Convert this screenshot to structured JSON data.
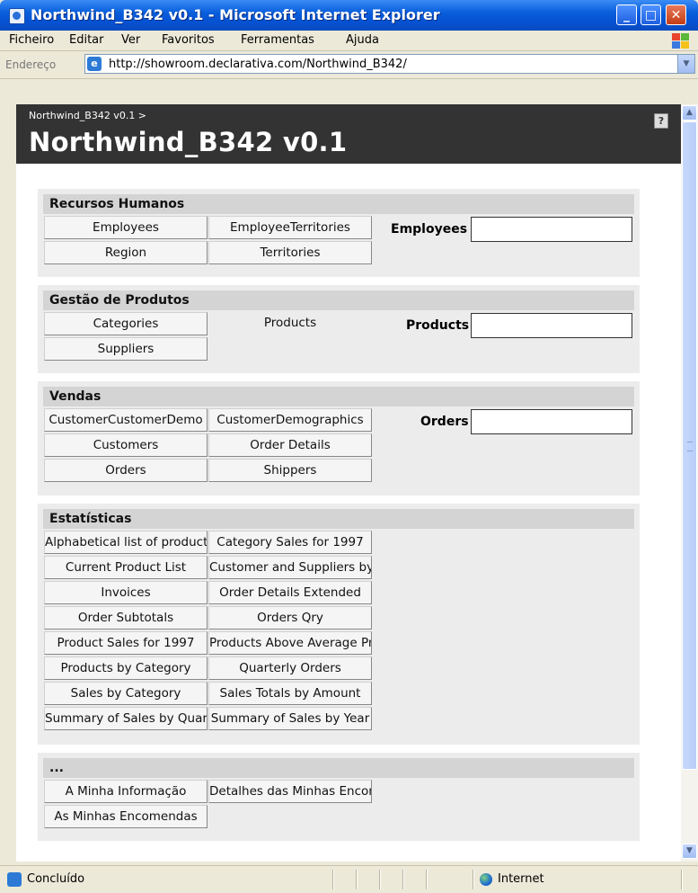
{
  "window": {
    "title": "Northwind_B342 v0.1 - Microsoft Internet Explorer",
    "minimize": "_",
    "maximize": "□",
    "close": "✕"
  },
  "menu": [
    "Ficheiro",
    "Editar",
    "Ver",
    "Favoritos",
    "Ferramentas",
    "Ajuda"
  ],
  "address": {
    "label": "Endereço",
    "url": "http://showroom.declarativa.com/Northwind_B342/"
  },
  "page": {
    "breadcrumb": "Northwind_B342 v0.1 >",
    "title": "Northwind_B342 v0.1",
    "help": "?"
  },
  "sections": [
    {
      "heading": "Recursos Humanos",
      "buttons": [
        "Employees",
        "EmployeeTerritories",
        "Region",
        "Territories"
      ],
      "field_label": "Employees"
    },
    {
      "heading": "Gestão de Produtos",
      "buttons": [
        "Categories",
        "Products",
        "Suppliers"
      ],
      "field_label": "Products"
    },
    {
      "heading": "Vendas",
      "buttons": [
        "CustomerCustomerDemo",
        "CustomerDemographics",
        "Customers",
        "Order Details",
        "Orders",
        "Shippers"
      ],
      "field_label": "Orders"
    },
    {
      "heading": "Estatísticas",
      "buttons": [
        "Alphabetical list of products",
        "Category Sales for 1997",
        "Current Product List",
        "Customer and Suppliers by City",
        "Invoices",
        "Order Details Extended",
        "Order Subtotals",
        "Orders Qry",
        "Product Sales for 1997",
        "Products Above Average Price",
        "Products by Category",
        "Quarterly Orders",
        "Sales by Category",
        "Sales Totals by Amount",
        "Summary of Sales by Quarter",
        "Summary of Sales by Year"
      ]
    },
    {
      "heading": "...",
      "buttons": [
        "A Minha Informação",
        "Detalhes das Minhas Encomendas",
        "As Minhas Encomendas"
      ]
    }
  ],
  "status": {
    "text": "Concluído",
    "zone": "Internet"
  }
}
